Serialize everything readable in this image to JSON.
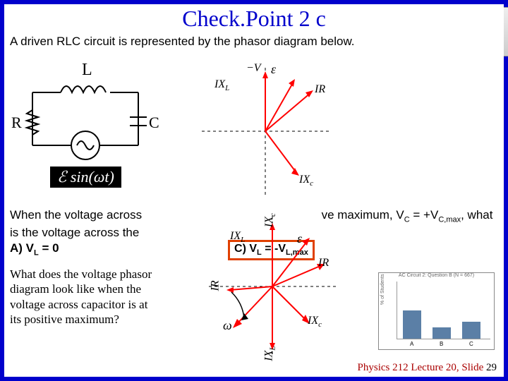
{
  "title": "Check.Point 2 c",
  "intro": "A driven RLC circuit is represented by the phasor diagram below.",
  "circuit": {
    "L": "L",
    "R": "R",
    "C": "C",
    "source": "ℰ sin(ωt)"
  },
  "phasor1": {
    "negV": "−V",
    "eps": "ε",
    "IR": "IR",
    "IXL": "IX",
    "IXL_sub": "L",
    "IXc": "IX",
    "IXc_sub": "c"
  },
  "question": {
    "line1_a": "When the voltage across",
    "line1_b": "ve maximum, V",
    "line1_c": " = +V",
    "line1_d": ", what",
    "sub_c1": "C",
    "sub_c2": "C,max",
    "line2": "is the voltage across the",
    "optA": "A)  V",
    "optA_sub": "L",
    "optA_tail": " = 0",
    "optC": "C) V",
    "optC_sub": "L",
    "optC_tail": " = -V",
    "optC_sub2": "L,max"
  },
  "phasor2": {
    "IXL": "IX",
    "IXL_sub": "L",
    "IXc": "IX",
    "IXc_sub": "c",
    "IR": "IR",
    "eps": "ε",
    "omega": "ω",
    "IXL_bot": "IX",
    "IXL_bot_sub": "L",
    "IXc_top": "IX",
    "IXc_top_sub": "c"
  },
  "prompt": "What does the voltage phasor diagram look like when the voltage across capacitor is at its positive maximum?",
  "chart_data": {
    "type": "bar",
    "title": "AC Circuit 2: Question B (N = 667)",
    "xlabel": "",
    "ylabel": "% of Students",
    "categories": [
      "A",
      "B",
      "C"
    ],
    "values": [
      50,
      20,
      30
    ],
    "ylim": [
      0,
      100
    ]
  },
  "footer": {
    "course": "Physics 212  Lecture 20, Slide",
    "num": "29"
  }
}
